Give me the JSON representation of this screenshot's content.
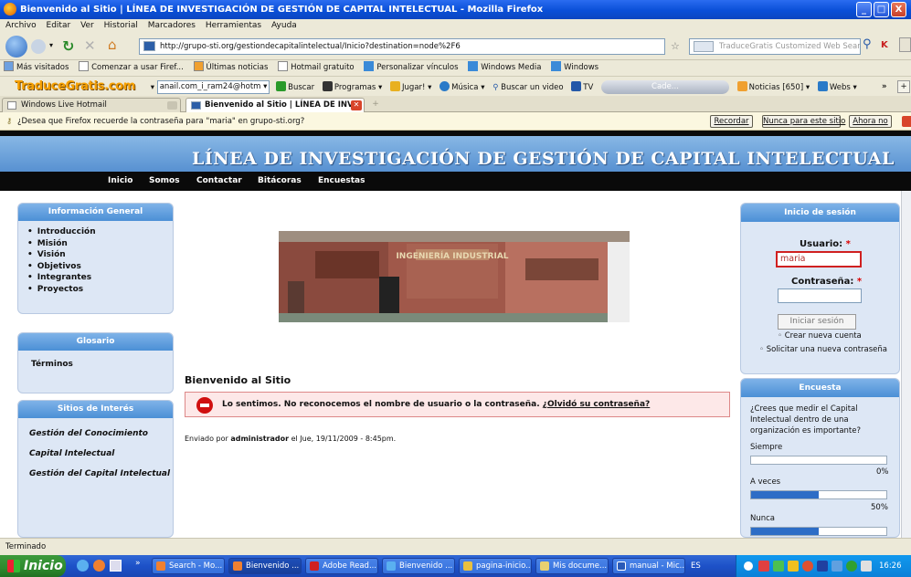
{
  "window": {
    "title": "Bienvenido al Sitio | LÍNEA DE INVESTIGACIÓN DE GESTIÓN DE CAPITAL INTELECTUAL - Mozilla Firefox",
    "min": "_",
    "max": "□",
    "close": "X"
  },
  "menu": [
    "Archivo",
    "Editar",
    "Ver",
    "Historial",
    "Marcadores",
    "Herramientas",
    "Ayuda"
  ],
  "nav": {
    "url": "http://grupo-sti.org/gestiondecapitalintelectual/Inicio?destination=node%2F6",
    "search_placeholder": "TraduceGratis Customized Web Search"
  },
  "bookmarks": [
    "Más visitados",
    "Comenzar a usar Firef...",
    "Últimas noticias",
    "Hotmail gratuito",
    "Personalizar vínculos",
    "Windows Media",
    "Windows"
  ],
  "toolbar": {
    "logo": "TraduceGratis.com",
    "email": "anail.com_i_ram24@hotm",
    "buscar": "Buscar",
    "programas": "Programas",
    "jugar": "Jugar!",
    "musica": "Música",
    "buscar_video": "Buscar un video",
    "tv": "TV",
    "cade": "Cade...",
    "noticias": "Noticias [650]",
    "webs": "Webs",
    "more": "»"
  },
  "tabs": [
    {
      "label": "Windows Live Hotmail"
    },
    {
      "label": "Bienvenido al Sitio | LÍNEA DE INV..."
    }
  ],
  "pwbar": {
    "message": "¿Desea que Firefox recuerde la contraseña para \"maria\" en grupo-sti.org?",
    "recordar": "Recordar",
    "nunca": "Nunca para este sitio",
    "ahora_no": "Ahora no"
  },
  "site": {
    "title": "LÍNEA DE INVESTIGACIÓN DE GESTIÓN DE CAPITAL INTELECTUAL",
    "nav": [
      "Inicio",
      "Somos",
      "Contactar",
      "Bitácoras",
      "Encuestas"
    ]
  },
  "left": {
    "info_title": "Información General",
    "info_items": [
      "Introducción",
      "Misión",
      "Visión",
      "Objetivos",
      "Integrantes",
      "Proyectos"
    ],
    "glosario_title": "Glosario",
    "glosario_items": [
      "Términos"
    ],
    "sitios_title": "Sitios de Interés",
    "sitios_items": [
      "Gestión del Conocimiento",
      "Capital Intelectual",
      "Gestión del Capital Intelectual"
    ]
  },
  "main": {
    "photo_sign": "INGENIERÍA INDUSTRIAL",
    "title": "Bienvenido al Sitio",
    "error": "Lo sentimos. No reconocemos el nombre de usuario o la contraseña.",
    "error_link": "¿Olvidó su contraseña?",
    "byline_pre": "Enviado por",
    "byline_author": "administrador",
    "byline_post": "el Jue, 19/11/2009 - 8:45pm."
  },
  "login": {
    "title": "Inicio de sesión",
    "user_label": "Usuario:",
    "user_value": "maria",
    "pass_label": "Contraseña:",
    "required": "*",
    "submit": "Iniciar sesión",
    "create": "Crear nueva cuenta",
    "request": "Solicitar una nueva contraseña"
  },
  "poll": {
    "title": "Encuesta",
    "question": "¿Crees que medir el Capital Intelectual dentro de una organización es importante?",
    "options": [
      {
        "label": "Siempre",
        "percent": 0,
        "text": "0%"
      },
      {
        "label": "A veces",
        "percent": 50,
        "text": "50%"
      },
      {
        "label": "Nunca",
        "percent": 50,
        "text": ""
      }
    ]
  },
  "status": "Terminado",
  "taskbar": {
    "start": "Inicio",
    "more": "»",
    "tasks": [
      "Search - Mo...",
      "Bienvenido ...",
      "Adobe Read...",
      "Bienvenido ...",
      "pagina-inicio...",
      "Mis docume...",
      "manual - Mic..."
    ],
    "lang": "ES",
    "clock": "16:26"
  },
  "colors": {
    "titlebar": "#0a4fd8",
    "site_header": "#5e96d4",
    "nav_black": "#0a0a0a",
    "box_bg": "#dde7f5",
    "error_bg": "#fde8e8",
    "poll_bar": "#2d6dc6"
  }
}
